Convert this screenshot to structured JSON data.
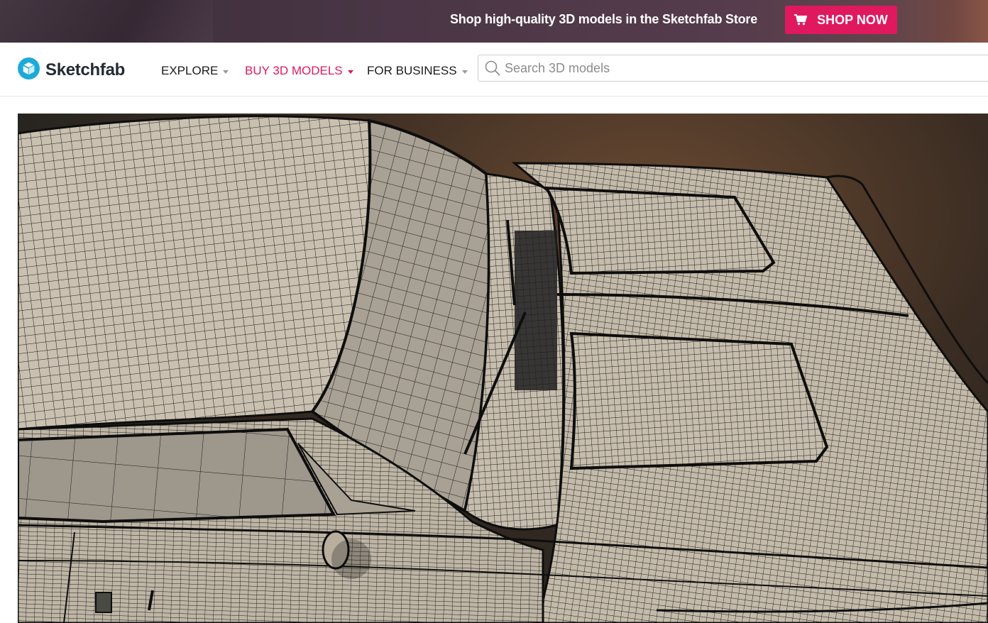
{
  "promo": {
    "text": "Shop high-quality 3D models in the Sketchfab Store",
    "button_label": "SHOP NOW",
    "button_icon": "shopping-cart-icon",
    "button_color": "#e0195e"
  },
  "header": {
    "logo_text": "Sketchfab",
    "logo_icon": "sketchfab-cube-icon",
    "brand_color": "#1caad9",
    "nav": [
      {
        "label": "EXPLORE",
        "active": false
      },
      {
        "label": "BUY 3D MODELS",
        "active": true
      },
      {
        "label": "FOR BUSINESS",
        "active": false
      }
    ],
    "active_color": "#e0195e",
    "search": {
      "placeholder": "Search 3D models",
      "value": "",
      "icon": "search-icon"
    }
  },
  "hero": {
    "subject": "wireframe-car-model",
    "mesh_color": "#c8beae",
    "wire_color": "#141414"
  }
}
